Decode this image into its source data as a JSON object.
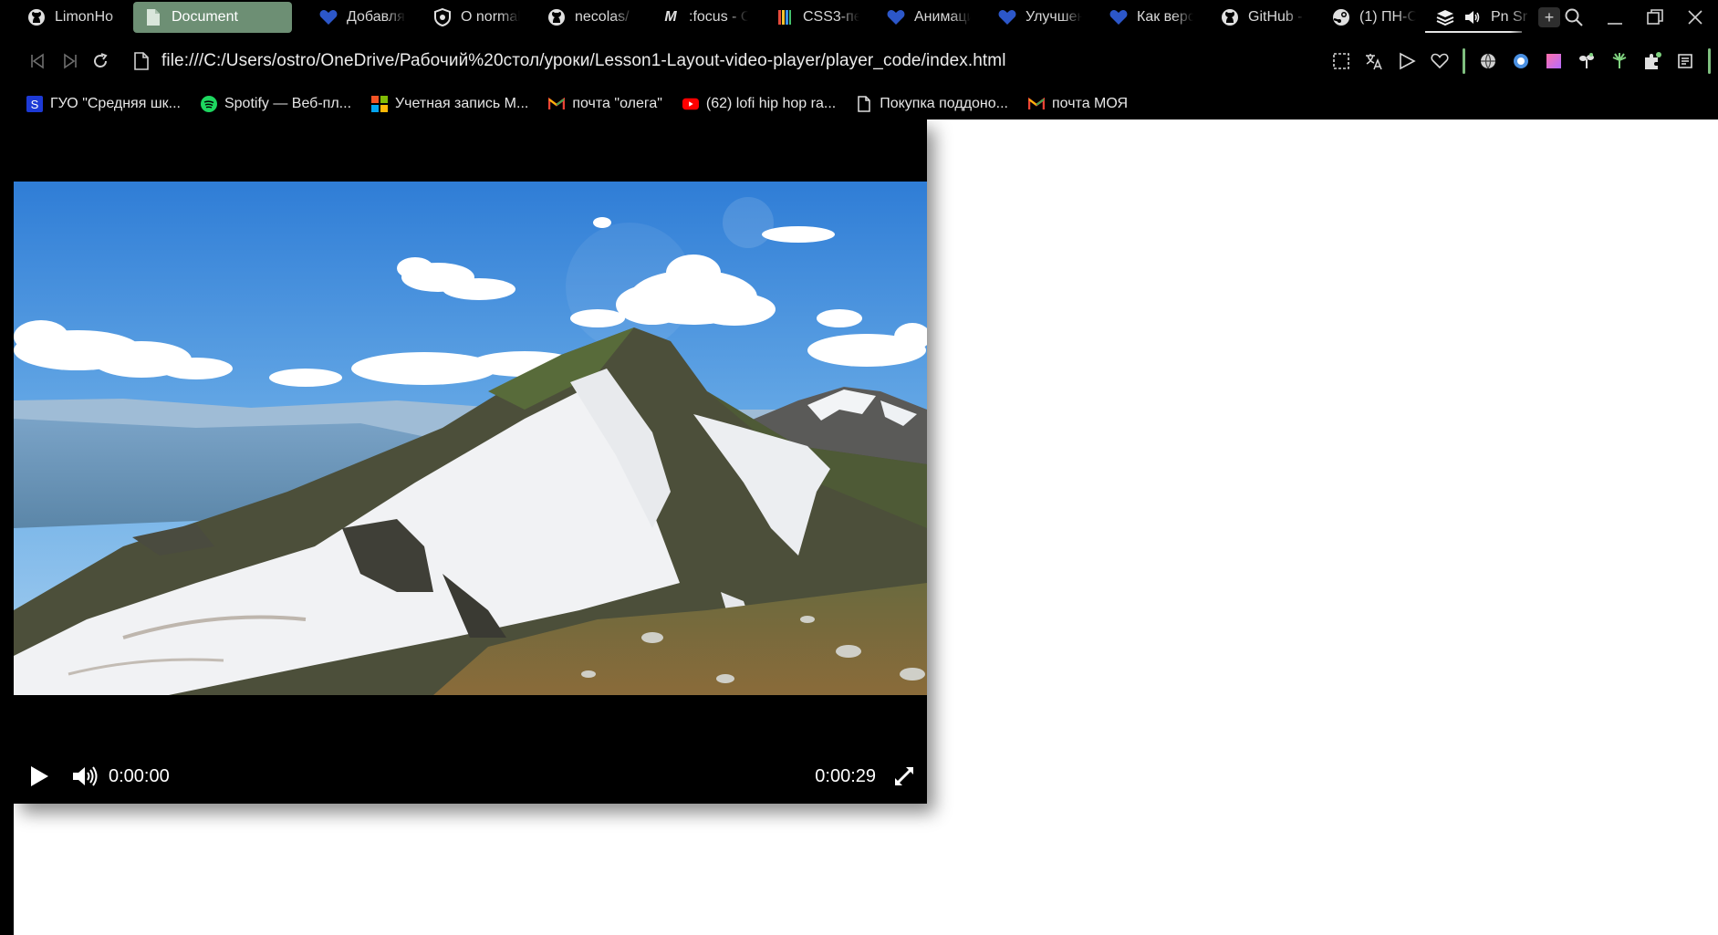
{
  "browser": {
    "tabs": [
      {
        "title": "LimonHo",
        "icon": "github-icon"
      },
      {
        "title": "Document",
        "icon": "page-icon",
        "active": true
      },
      {
        "title": "Добавля",
        "icon": "heart-icon"
      },
      {
        "title": "О normal",
        "icon": "shield-icon"
      },
      {
        "title": "necolas/",
        "icon": "github-icon"
      },
      {
        "title": ":focus - C",
        "icon": "mdn-icon"
      },
      {
        "title": "CSS3-пе",
        "icon": "css-icon"
      },
      {
        "title": "Анимаци",
        "icon": "heart-icon"
      },
      {
        "title": "Улучшен",
        "icon": "heart-icon"
      },
      {
        "title": "Как верс",
        "icon": "heart-icon"
      },
      {
        "title": "GitHub -",
        "icon": "github-icon"
      },
      {
        "title": "(1) ПН-С",
        "icon": "steam-icon"
      },
      {
        "title": "Pn Sr",
        "icon": "stack-icon",
        "audio": true
      }
    ],
    "url": "file:///C:/Users/ostro/OneDrive/Рабочий%20стол/уроки/Lesson1-Layout-video-player/player_code/index.html",
    "bookmarks": [
      {
        "label": "ГУО \"Средняя шк...",
        "icon": "s-icon"
      },
      {
        "label": "Spotify — Веб-пл...",
        "icon": "spotify-icon"
      },
      {
        "label": "Учетная запись М...",
        "icon": "microsoft-icon"
      },
      {
        "label": "почта \"олега\"",
        "icon": "gmail-icon"
      },
      {
        "label": "(62) lofi hip hop ra...",
        "icon": "youtube-icon"
      },
      {
        "label": "Покупка поддоно...",
        "icon": "page-icon"
      },
      {
        "label": "почта МОЯ",
        "icon": "gmail-icon"
      }
    ]
  },
  "player": {
    "current_time": "0:00:00",
    "duration": "0:00:29",
    "progress": 0
  },
  "colors": {
    "active_tab": "#6d8f74",
    "chrome_bg": "#000000",
    "page_bg": "#ffffff"
  }
}
